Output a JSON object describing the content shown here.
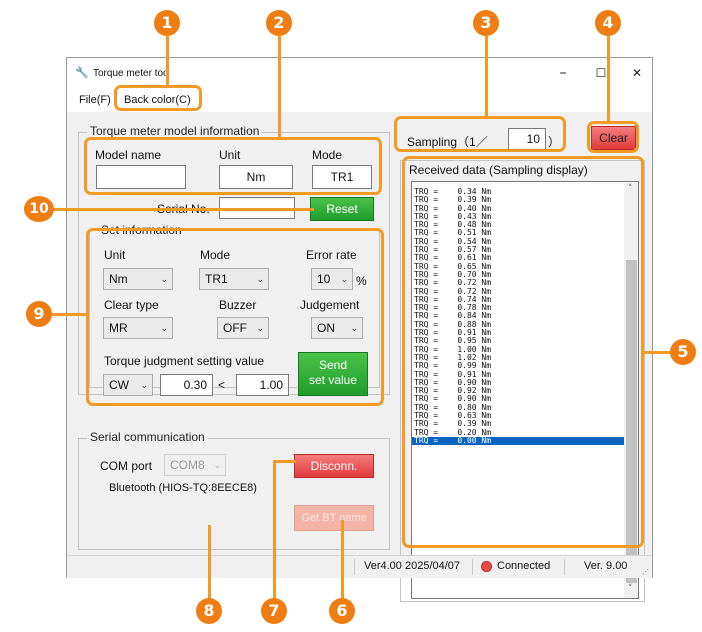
{
  "window": {
    "title": "Torque meter too"
  },
  "window_controls": {
    "minimize": "–",
    "maximize": "☐",
    "close": "✕"
  },
  "menu": {
    "file": "File(F)",
    "back_color": "Back color(C)"
  },
  "model_info": {
    "group_title": "Torque meter model information",
    "model_name_label": "Model name",
    "unit_label": "Unit",
    "mode_label": "Mode",
    "model_name_value": "",
    "unit_value": "Nm",
    "mode_value": "TR1",
    "serial_label": "Serial No.",
    "serial_value": "",
    "reset_label": "Reset"
  },
  "set_info": {
    "group_title": "Set information",
    "unit_label": "Unit",
    "mode_label": "Mode",
    "error_rate_label": "Error rate",
    "unit_value": "Nm",
    "mode_value": "TR1",
    "error_rate_value": "10",
    "percent": "%",
    "clear_type_label": "Clear type",
    "buzzer_label": "Buzzer",
    "judgement_label": "Judgement",
    "clear_type_value": "MR",
    "buzzer_value": "OFF",
    "judgement_value": "ON",
    "judgment_setting_label": "Torque judgment setting value",
    "direction_value": "CW",
    "lower_value": "0.30",
    "lt": "<",
    "upper_value": "1.00",
    "send_line1": "Send",
    "send_line2": "set value"
  },
  "serial_comm": {
    "group_title": "Serial communication",
    "com_port_label": "COM port",
    "com_port_value": "COM8",
    "bluetooth_text": "Bluetooth (HIOS-TQ:8EECE8)",
    "disconn_label": "Disconn.",
    "get_bt_label": "Get BT name"
  },
  "sampling": {
    "label": "Sampling（1／",
    "value": "10",
    "close": "）",
    "clear_label": "Clear"
  },
  "received": {
    "group_title": "Received data (Sampling display)",
    "rows": [
      "TRQ =    0.34 Nm",
      "TRQ =    0.39 Nm",
      "TRQ =    0.40 Nm",
      "TRQ =    0.43 Nm",
      "TRQ =    0.48 Nm",
      "TRQ =    0.51 Nm",
      "TRQ =    0.54 Nm",
      "TRQ =    0.57 Nm",
      "TRQ =    0.61 Nm",
      "TRQ =    0.65 Nm",
      "TRQ =    0.70 Nm",
      "TRQ =    0.72 Nm",
      "TRQ =    0.72 Nm",
      "TRQ =    0.74 Nm",
      "TRQ =    0.78 Nm",
      "TRQ =    0.84 Nm",
      "TRQ =    0.88 Nm",
      "TRQ =    0.91 Nm",
      "TRQ =    0.95 Nm",
      "TRQ =    1.00 Nm",
      "TRQ =    1.02 Nm",
      "TRQ =    0.99 Nm",
      "TRQ =    0.91 Nm",
      "TRQ =    0.90 Nm",
      "TRQ =    0.92 Nm",
      "TRQ =    0.90 Nm",
      "TRQ =    0.80 Nm",
      "TRQ =    0.63 Nm",
      "TRQ =    0.39 Nm",
      "TRQ =    0.20 Nm",
      "TRQ =    0.00 Nm"
    ],
    "selected_index": 30
  },
  "status": {
    "version_date": "Ver4.00 2025/04/07",
    "connection": "Connected",
    "fw_version": "Ver. 9.00"
  },
  "callouts": [
    "1",
    "2",
    "3",
    "4",
    "5",
    "6",
    "7",
    "8",
    "9",
    "10"
  ],
  "colors": {
    "accent": "#f07d12",
    "green_button": "#2aa83a",
    "red_button": "#e94848",
    "selection": "#0a64c0"
  }
}
